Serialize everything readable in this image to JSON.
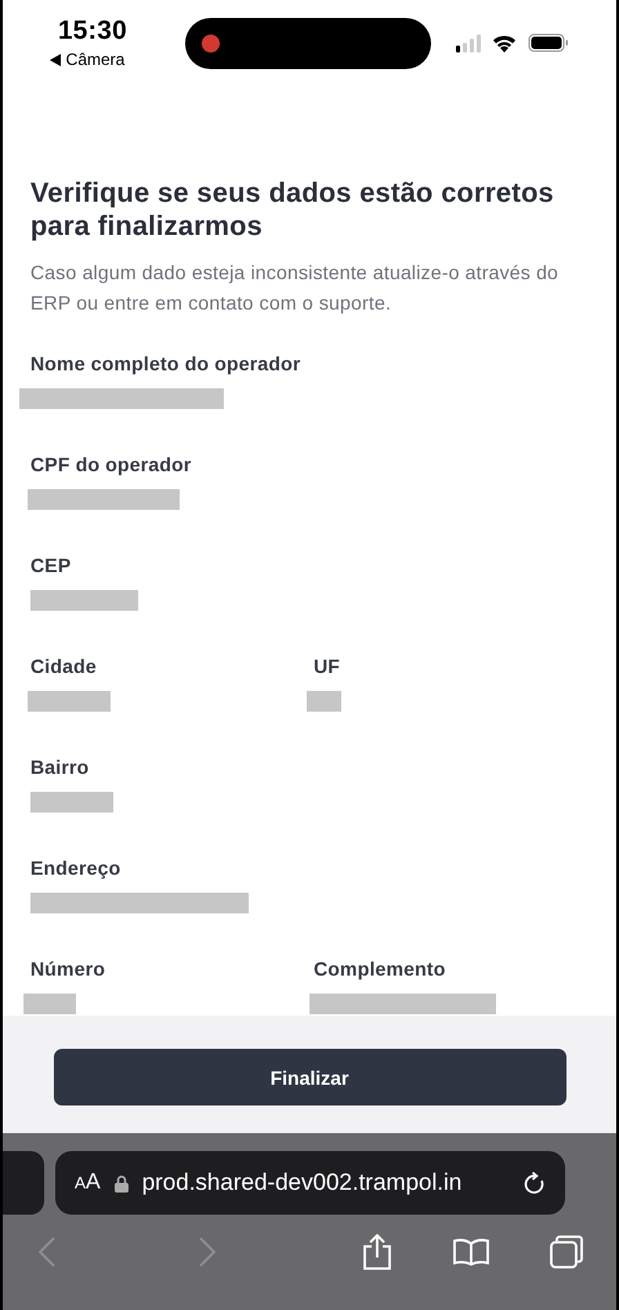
{
  "status_bar": {
    "time": "15:30",
    "back_label": "Câmera",
    "recording": true
  },
  "heading": "Verifique se seus dados estão corretos para finalizarmos",
  "description": "Caso algum dado esteja inconsistente atualize-o através do ERP ou entre em contato com o suporte.",
  "rows": [
    {
      "fields": [
        {
          "label": "Nome completo do operador"
        }
      ]
    },
    {
      "fields": [
        {
          "label": "CPF do operador"
        }
      ]
    },
    {
      "fields": [
        {
          "label": "CEP"
        }
      ]
    },
    {
      "fields": [
        {
          "label": "Cidade"
        },
        {
          "label": "UF"
        }
      ]
    },
    {
      "fields": [
        {
          "label": "Bairro"
        }
      ]
    },
    {
      "fields": [
        {
          "label": "Endereço"
        }
      ]
    },
    {
      "fields": [
        {
          "label": "Número"
        },
        {
          "label": "Complemento"
        }
      ]
    }
  ],
  "button": "Finalizar",
  "browser": {
    "text_size": "AA",
    "url": "prod.shared-dev002.trampol.in",
    "back_disabled": true,
    "forward_disabled": true
  }
}
